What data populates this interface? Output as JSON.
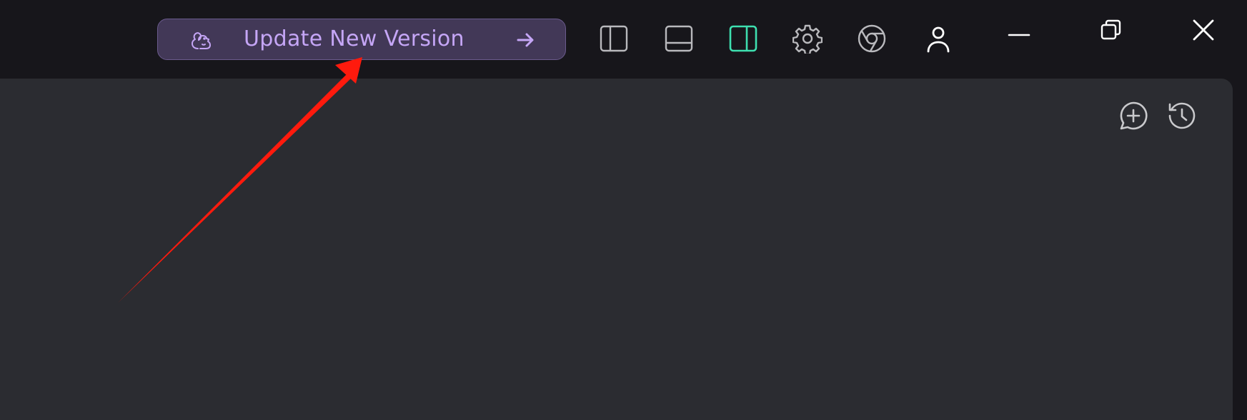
{
  "titlebar": {
    "update_button": {
      "label": "Update New Version",
      "icon": "squirrel-icon",
      "trailing_icon": "arrow-right-icon",
      "text_color": "#c5a6f6",
      "background": "#423857"
    },
    "layout_toggles": [
      {
        "name": "toggle-left-sidebar",
        "icon": "panel-left-icon",
        "active": false
      },
      {
        "name": "toggle-bottom-panel",
        "icon": "panel-bottom-icon",
        "active": false
      },
      {
        "name": "toggle-right-sidebar",
        "icon": "panel-right-icon",
        "active": true
      }
    ],
    "tools": [
      {
        "name": "settings",
        "icon": "gear-icon"
      },
      {
        "name": "browser",
        "icon": "chrome-icon"
      },
      {
        "name": "account",
        "icon": "user-icon"
      }
    ],
    "window_controls": [
      {
        "name": "minimize",
        "icon": "minimize-icon"
      },
      {
        "name": "restore",
        "icon": "restore-icon"
      },
      {
        "name": "close",
        "icon": "close-icon"
      }
    ],
    "accent_active": "#3ee0b0"
  },
  "panel": {
    "actions": [
      {
        "name": "new-chat",
        "icon": "chat-plus-icon"
      },
      {
        "name": "history",
        "icon": "history-icon"
      }
    ],
    "background": "#2b2c31"
  },
  "annotation": {
    "type": "arrow",
    "color": "#ff1a0d",
    "points_to": "update-button"
  }
}
